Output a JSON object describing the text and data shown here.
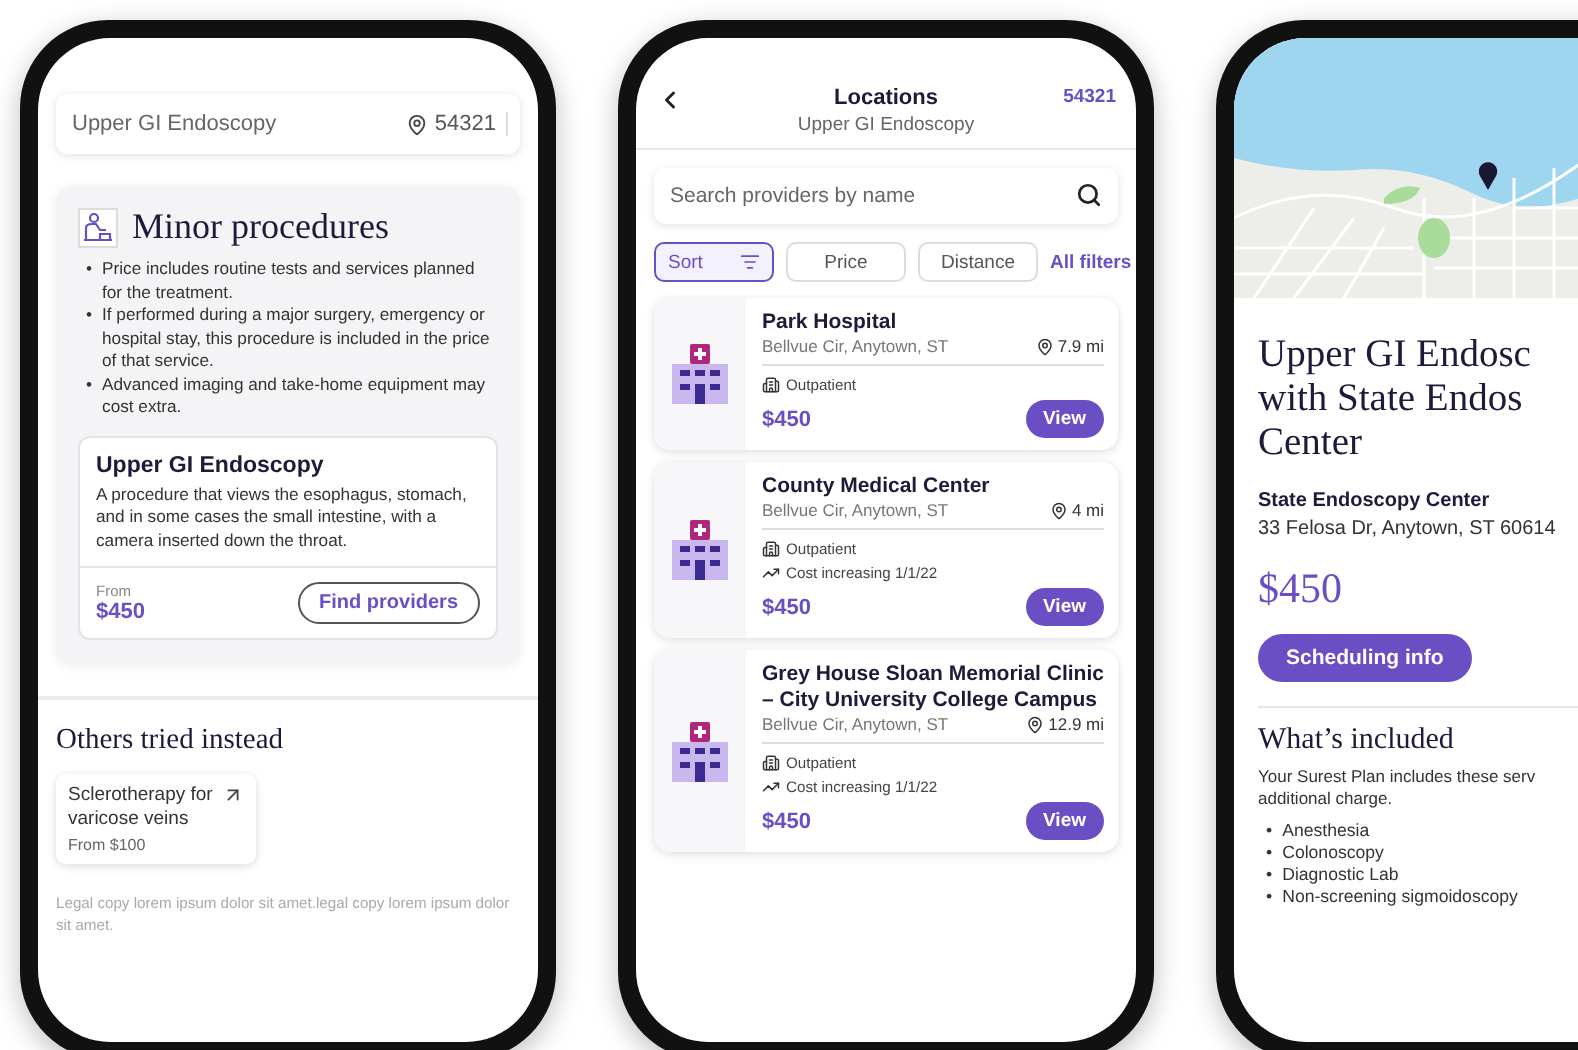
{
  "procedure_screen": {
    "search": {
      "value": "Upper GI Endoscopy",
      "zip": "54321"
    },
    "category": {
      "title": "Minor procedures",
      "bullets": [
        {
          "marker": "•",
          "text": "Price includes routine tests and services planned for the treatment."
        },
        {
          "marker": "•",
          "text": "If performed during a major surgery, emergency or hospital stay, this procedure is included in the price of that service."
        },
        {
          "marker": "•",
          "text": "Advanced imaging and take-home equipment may cost extra."
        }
      ]
    },
    "procedure_card": {
      "title": "Upper GI Endoscopy",
      "description": "A procedure that views the esophagus, stomach, and in some cases the small intestine, with a camera inserted down the throat.",
      "price_label": "From",
      "price": "$450",
      "button": "Find providers"
    },
    "alternatives": {
      "title": "Others tried instead",
      "items": [
        {
          "name": "Sclerotherapy for varicose veins",
          "price": "From $100"
        }
      ]
    },
    "legal": "Legal copy lorem ipsum dolor sit amet.legal copy lorem ipsum dolor sit amet."
  },
  "locations_screen": {
    "header": {
      "title": "Locations",
      "subtitle": "Upper GI Endoscopy",
      "zip": "54321"
    },
    "search": {
      "placeholder": "Search providers by name"
    },
    "filters": [
      {
        "label": "Sort",
        "selected": true
      },
      {
        "label": "Price",
        "selected": false
      },
      {
        "label": "Distance",
        "selected": false
      }
    ],
    "all_filters": "All filters",
    "providers": [
      {
        "name": "Park Hospital",
        "address": "Bellvue Cir, Anytown, ST",
        "distance": "7.9 mi",
        "tags": [
          {
            "kind": "care",
            "text": "Outpatient"
          }
        ],
        "price": "$450",
        "action": "View"
      },
      {
        "name": "County Medical Center",
        "address": "Bellvue Cir, Anytown, ST",
        "distance": "4 mi",
        "tags": [
          {
            "kind": "care",
            "text": "Outpatient"
          },
          {
            "kind": "cost",
            "text": "Cost increasing 1/1/22"
          }
        ],
        "price": "$450",
        "action": "View"
      },
      {
        "name": "Grey House Sloan Memorial Clinic – City University College Campus",
        "address": "Bellvue Cir, Anytown, ST",
        "distance": "12.9 mi",
        "tags": [
          {
            "kind": "care",
            "text": "Outpatient"
          },
          {
            "kind": "cost",
            "text": "Cost increasing 1/1/22"
          }
        ],
        "price": "$450",
        "action": "View"
      }
    ]
  },
  "detail_screen": {
    "title": "Upper GI Endosc with State Endos Center",
    "provider": "State Endoscopy Center",
    "address": "33 Felosa Dr, Anytown, ST 60614",
    "price": "$450",
    "button": "Scheduling info",
    "included": {
      "title": "What’s included",
      "text": "Your Surest Plan includes these serv additional charge.",
      "items": [
        {
          "marker": "•",
          "text": "Anesthesia"
        },
        {
          "marker": "•",
          "text": "Colonoscopy"
        },
        {
          "marker": "•",
          "text": "Diagnostic Lab"
        },
        {
          "marker": "•",
          "text": "Non-screening sigmoidoscopy"
        }
      ]
    }
  }
}
